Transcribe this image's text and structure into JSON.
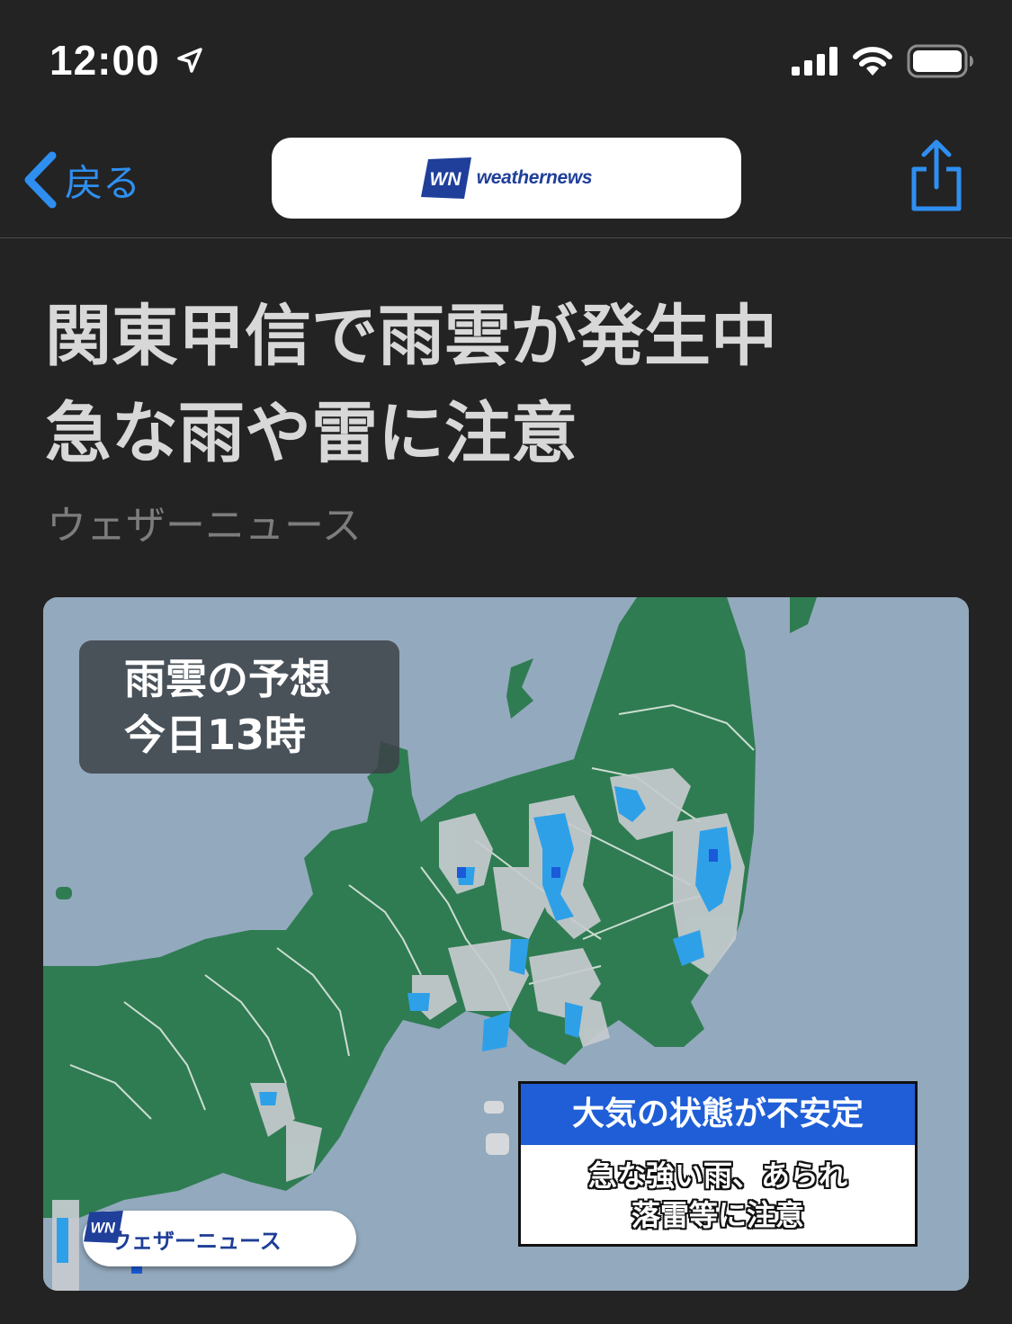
{
  "status_bar": {
    "time": "12:00"
  },
  "nav": {
    "back_label": "戻る",
    "logo_text": "weathernews"
  },
  "article": {
    "headline_line1": "関東甲信で雨雲が発生中",
    "headline_line2": "急な雨や雷に注意",
    "source": "ウェザーニュース"
  },
  "figure": {
    "forecast_line1": "雨雲の予想",
    "forecast_line2": "今日13時",
    "alert_title": "大気の状態が不安定",
    "alert_line1": "急な強い雨、あられ",
    "alert_line2": "落雷等に注意",
    "badge_text": "ウェザーニュース"
  },
  "colors": {
    "background": "#232323",
    "accent": "#2f8ff0",
    "sea": "#93a9bd",
    "land": "#2f7c52",
    "alert_blue": "#1f5ed6",
    "brand_blue": "#1f3f9a"
  }
}
